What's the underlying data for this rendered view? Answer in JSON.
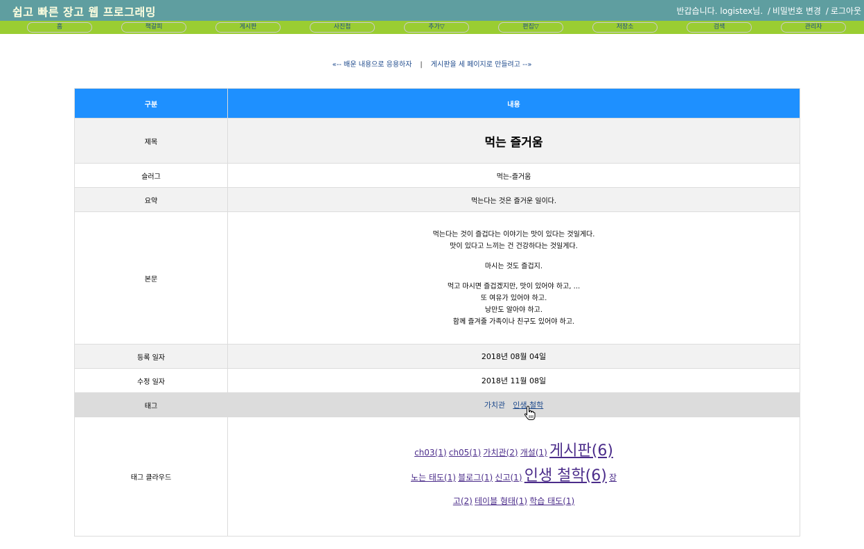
{
  "header": {
    "site_title": "쉽고 빠른 장고 웹 프로그래밍",
    "greeting": "반갑습니다. logistex님.",
    "change_password": "비밀번호 변경",
    "logout": "로그아웃",
    "separator": "/"
  },
  "menu": {
    "items": [
      "홈",
      "책갈피",
      "게시판",
      "사진첩",
      "추가▽",
      "편집▽",
      "저장소",
      "검색",
      "관리자"
    ]
  },
  "pager": {
    "prev": "«-- 배운 내용으로 응용하자",
    "divider": "|",
    "next": "게시판을 세 페이지로 만들려고 --»"
  },
  "table": {
    "col_label": "구분",
    "col_content": "내용",
    "rows": {
      "title_label": "제목",
      "title_value": "먹는 즐거움",
      "slug_label": "슬러그",
      "slug_value": "먹는-즐거움",
      "summary_label": "요약",
      "summary_value": "먹는다는 것은 즐거운 일이다.",
      "body_label": "본문",
      "body_lines": [
        "먹는다는 것이 즐겁다는 이야기는 맛이 있다는 것일게다.",
        "맛이 있다고 느끼는 건 건강하다는 것일게다.",
        "마시는 것도 즐겁지.",
        "먹고 마시면 즐겁겠지만, 맛이 있어야 하고, ...",
        "또 여유가 있어야 하고.",
        "낭만도 알아야 하고.",
        "함께 즐겨줄 가족이나 친구도 있어야 하고."
      ],
      "created_label": "등록 일자",
      "created_value": "2018년 08월 04일",
      "modified_label": "수정 일자",
      "modified_value": "2018년 11월 08일",
      "tags_label": "태그",
      "tags": [
        "가치관",
        "인생 철학"
      ],
      "cloud_label": "태그 클라우드"
    }
  },
  "tag_cloud": [
    {
      "name": "ch03",
      "count": "(1)",
      "size": "s"
    },
    {
      "name": "ch05",
      "count": "(1)",
      "size": "s"
    },
    {
      "name": "가치관",
      "count": "(2)",
      "size": "s"
    },
    {
      "name": "개설",
      "count": "(1)",
      "size": "s"
    },
    {
      "name": "게시판",
      "count": "(6)",
      "size": "l"
    },
    {
      "name": "노는 태도",
      "count": "(1)",
      "size": "s"
    },
    {
      "name": "블로그",
      "count": "(1)",
      "size": "s"
    },
    {
      "name": "신고",
      "count": "(1)",
      "size": "s"
    },
    {
      "name": "인생 철학",
      "count": "(6)",
      "size": "l"
    },
    {
      "name": "장고",
      "count": "(2)",
      "size": "s"
    },
    {
      "name": "테이블 형태",
      "count": "(1)",
      "size": "s"
    },
    {
      "name": "학습 태도",
      "count": "(1)",
      "size": "s"
    }
  ],
  "colors": {
    "topbar": "#5f9ea0",
    "menubar": "#9acd32",
    "table_header": "#1e90ff",
    "link": "#1e4a8c",
    "cloud_link": "#4b2c8a"
  },
  "icons": {
    "cursor": "hand-pointer-icon"
  }
}
